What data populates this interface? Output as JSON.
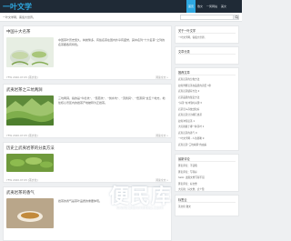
{
  "header": {
    "logo": "一叶文学",
    "nav": [
      "首页",
      "散文",
      "一笑网站",
      "美文"
    ],
    "tagline": "一叶文学网，客载大世界。"
  },
  "posts": [
    {
      "title": "中国十大名茶",
      "excerpt": "中国茶叶历史悠久，种类繁多，有些名茶在国内外享有盛誉，其中名列“十大名茶”之列的名茶都各有特色。",
      "meta": "YFW 2020.07.05 [茶文化]",
      "read_more": "阅读全文 »"
    },
    {
      "title": "武夷岩茶之三坑两涧",
      "excerpt": "三坑两涧，指的是“牛栏坑”、“慧苑坑”、“倒水坑”、“流香涧”、“悟源涧”这五个地方。地处核心景区内的岩茶产地被称为正岩茶。",
      "meta": "YFW 2020.07.05 [茶文化]",
      "read_more": "阅读全文 »"
    },
    {
      "title": "历史上武夷岩茶的分类方法",
      "excerpt": "",
      "meta": "YFW 2020.07.05 [茶文化]",
      "read_more": "阅读全文 »"
    },
    {
      "title": "武夷岩茶的香气",
      "excerpt": "岩茶的香气是茶叶品质的重要体现。",
      "meta": "",
      "read_more": ""
    }
  ],
  "sidebar": {
    "widgets": [
      {
        "title": "关于一叶文学",
        "lines": [
          "一叶文学网，客载大世界。"
        ]
      },
      {
        "title": "文章分类",
        "lines": []
      },
      {
        "title": "推荐文章",
        "lines": [
          "武夷岩茶的分类方法",
          "如何判断岩茶在品质的高低 3条",
          "武夷岩茶储存方法 2",
          "岩茶品质的鉴定方法",
          "“好茶”在冲泡时关键 3",
          "岩茶怎么存放比较好",
          "武夷岩茶分为哪几类茶",
          "如何冲泡岩茶 1",
          "大红袍属于哪一种茶叶 1",
          "武夷岩茶的香气 0",
          "一叶文学网 - 人生随笔 0",
          "武夷岩茶“三坑两涧”的由来"
        ]
      },
      {
        "title": "最新评论",
        "lines": [
          "匿名评论：不错哦",
          "匿名评论：写得好",
          "hello: 这篇文章写得不错",
          "匿名评论：好文章",
          "大红袍：好文章，点个赞"
        ]
      },
      {
        "title": "标签云",
        "lines": [
          "茶文化 散文"
        ]
      }
    ]
  },
  "watermark": {
    "text": "便民库",
    "url": "www.bianminku.com"
  }
}
